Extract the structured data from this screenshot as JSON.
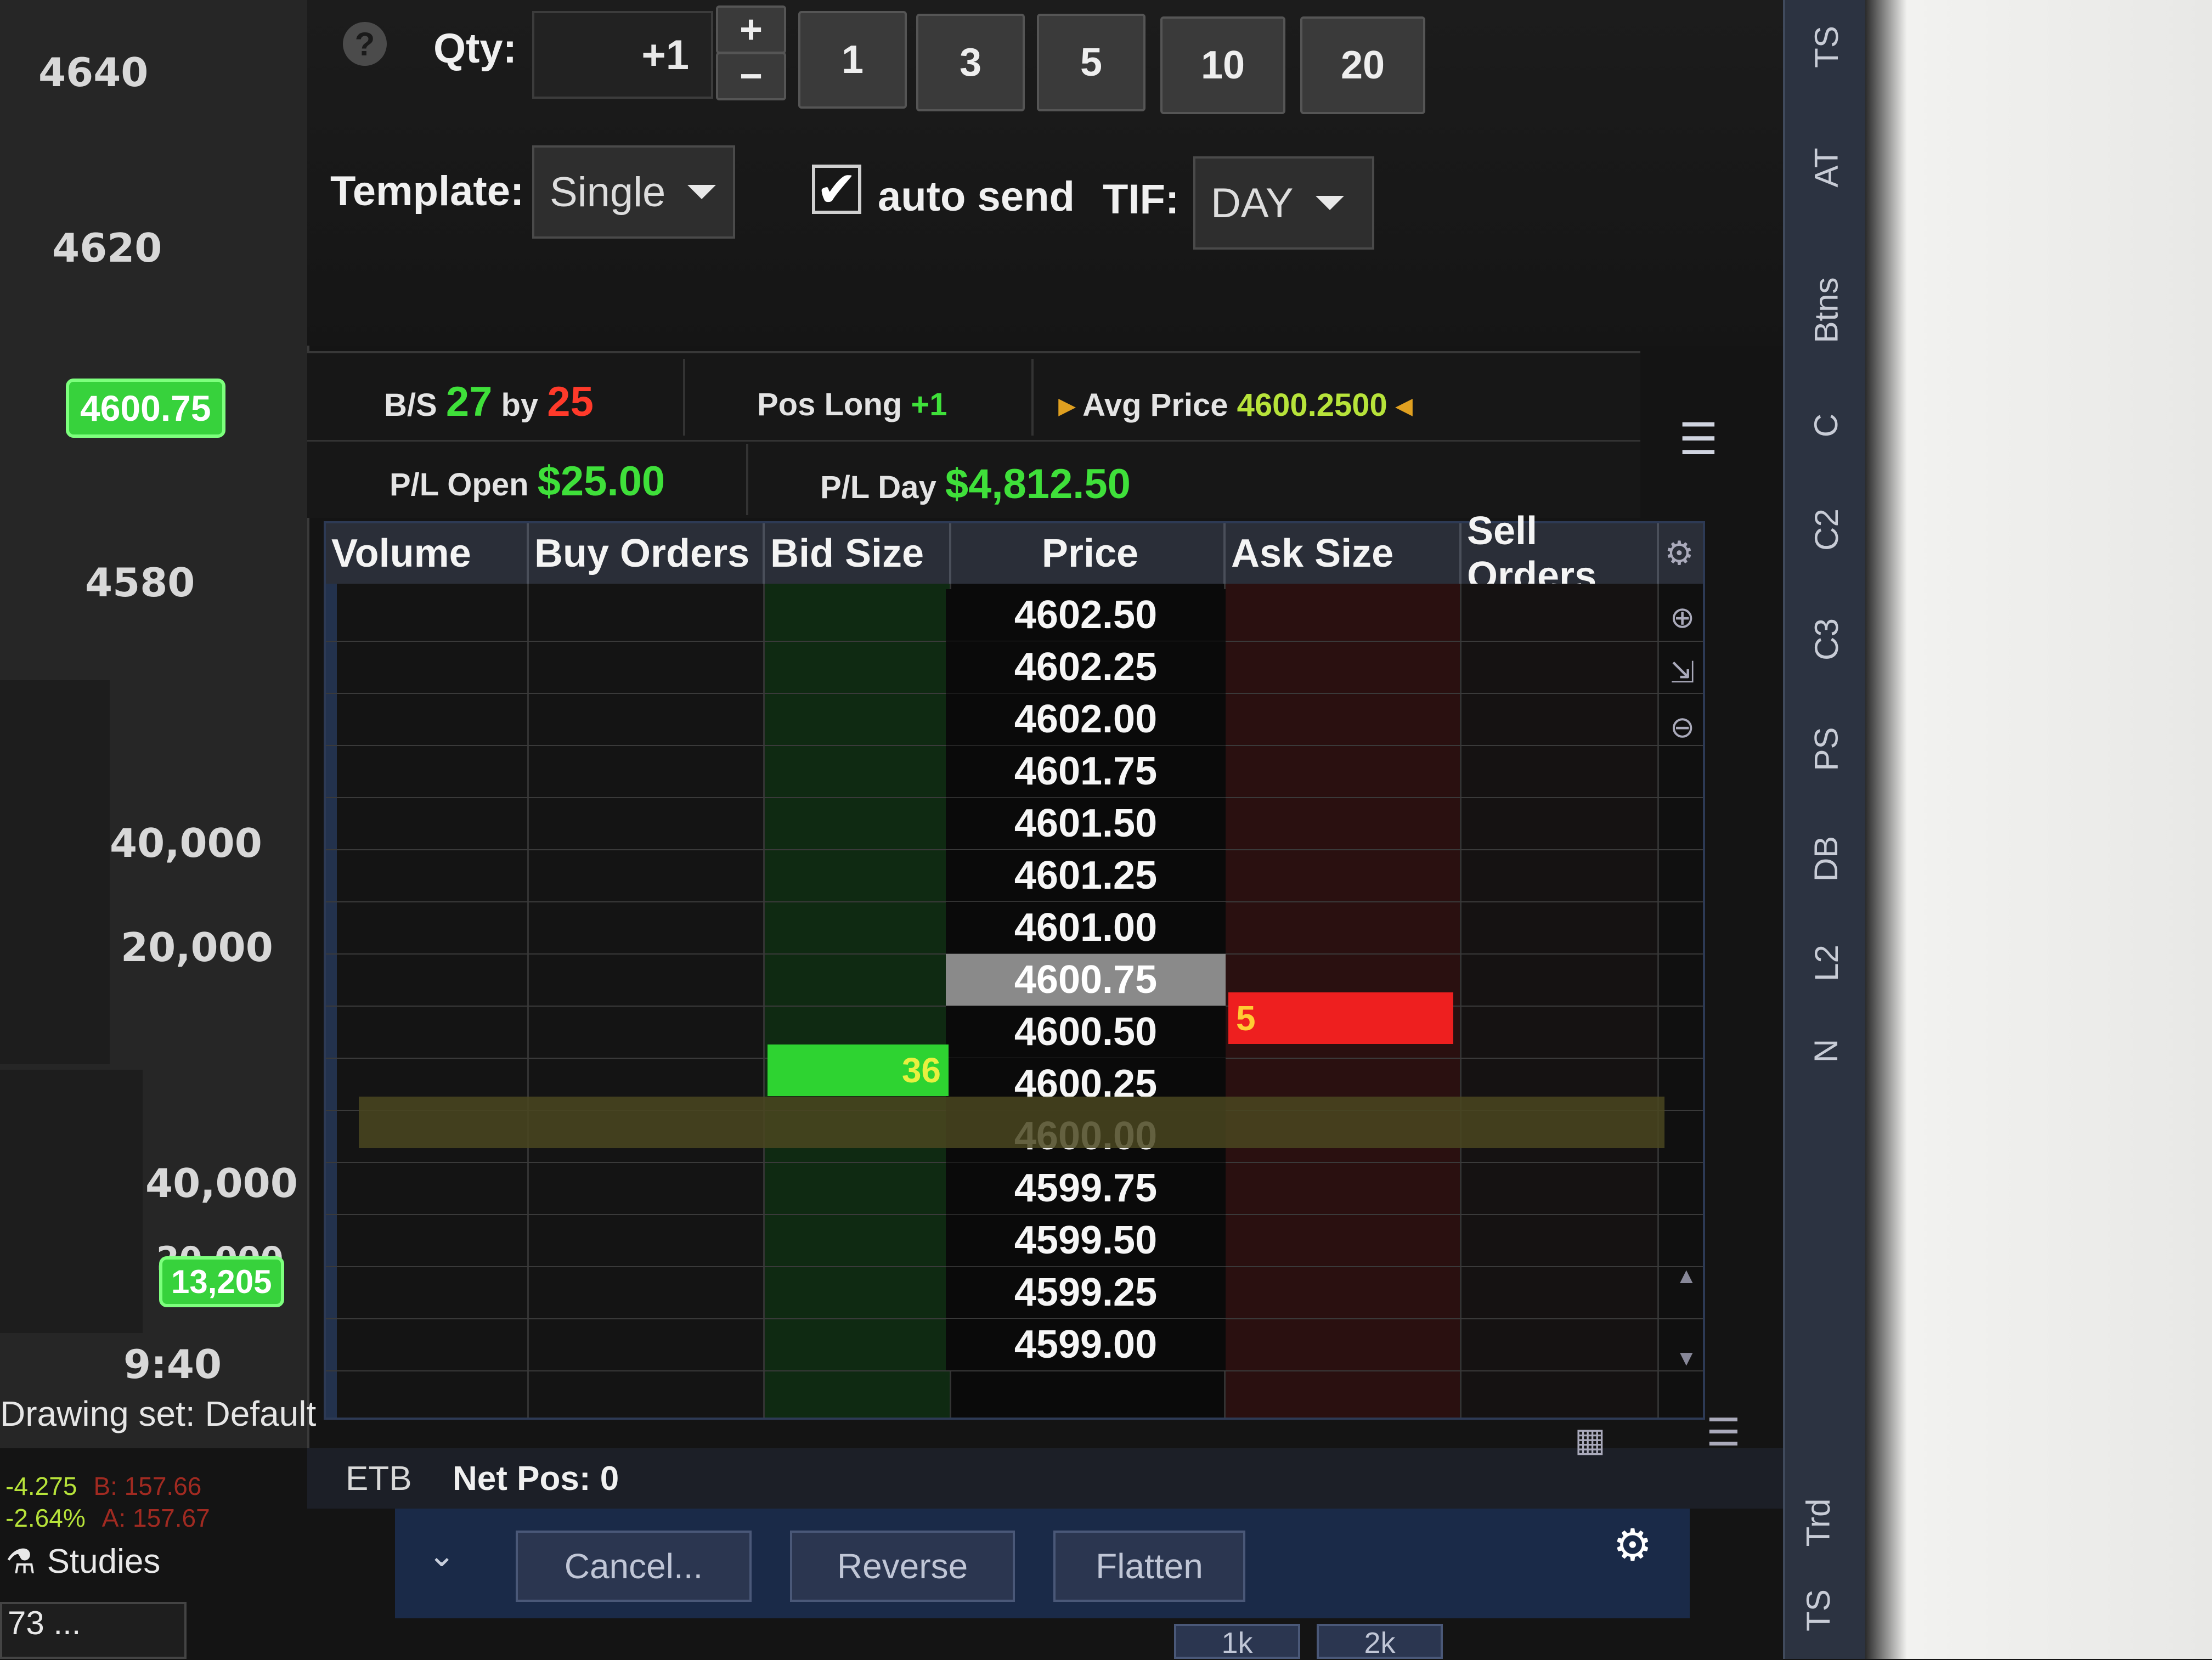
{
  "chart": {
    "price_ticks": [
      "4640",
      "4620",
      "4580"
    ],
    "last_price": "4600.75",
    "volume_ticks_upper": [
      "40,000",
      "20,000"
    ],
    "volume_ticks_lower": [
      "40,000",
      "20,000"
    ],
    "volume_badge": "13,205",
    "time_label": "9:40",
    "drawing_set": "Drawing set: Default",
    "quote_change": "-4.275",
    "quote_pct": "-2.64%",
    "quote_bid": "B: 157.66",
    "quote_ask": "A: 157.67",
    "studies": "Studies",
    "mini_value": "73 ..."
  },
  "order_entry": {
    "help_icon": "?",
    "qty_label": "Qty:",
    "qty_value": "+1",
    "plus": "+",
    "minus": "−",
    "qty_presets": [
      "1",
      "3",
      "5",
      "10",
      "20"
    ],
    "template_label": "Template:",
    "template_value": "Single",
    "auto_send_label": "auto send",
    "tif_label": "TIF:",
    "tif_value": "DAY"
  },
  "stats": {
    "bs_label": "B/S",
    "bs_buy": "27",
    "bs_by": "by",
    "bs_sell": "25",
    "pos_label": "Pos Long",
    "pos_value": "+1",
    "avg_label": "Avg Price",
    "avg_value": "4600.2500",
    "pl_open_label": "P/L Open",
    "pl_open_value": "$25.00",
    "pl_day_label": "P/L Day",
    "pl_day_value": "$4,812.50"
  },
  "ladder": {
    "columns": [
      "Volume",
      "Buy Orders",
      "Bid Size",
      "Price",
      "Ask Size",
      "Sell Orders"
    ],
    "prices": [
      "4602.50",
      "4602.25",
      "4602.00",
      "4601.75",
      "4601.50",
      "4601.25",
      "4601.00",
      "4600.75",
      "4600.50",
      "4600.25",
      "4600.00",
      "4599.75",
      "4599.50",
      "4599.25",
      "4599.00"
    ],
    "ask_size_at_4600_75": "5",
    "bid_size_at_4600_50": "36"
  },
  "side_tabs": [
    "TS",
    "AT",
    "Btns",
    "C",
    "C2",
    "C3",
    "PS",
    "DB",
    "L2",
    "N"
  ],
  "bottom_tabs": [
    "Trd",
    "TS"
  ],
  "status_bar": {
    "etb": "ETB",
    "net_pos": "Net Pos: 0"
  },
  "actions": {
    "cancel": "Cancel...",
    "reverse": "Reverse",
    "flatten": "Flatten",
    "qty_buttons_partial": [
      "1k",
      "2k"
    ]
  },
  "colors": {
    "bid_green": "#2ed331",
    "ask_red": "#ee1f1f",
    "profit_green": "#3fe03a",
    "loss_red": "#ff3a2a",
    "avg_price_lime": "#b7e33a"
  }
}
